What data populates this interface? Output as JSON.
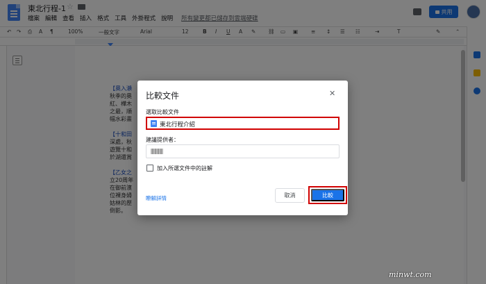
{
  "header": {
    "title": "東北行程-1",
    "menus": [
      "檔案",
      "編輯",
      "查看",
      "插入",
      "格式",
      "工具",
      "外掛程式",
      "說明"
    ],
    "saved_status": "所有變更都已儲存到雲端硬碟",
    "share_label": "共用"
  },
  "toolbar": {
    "zoom": "100%",
    "style": "一般文字",
    "font": "Arial",
    "size": "12"
  },
  "document": {
    "lines": [
      "【奧入瀨",
      "秋季的奧",
      "紅、樺木",
      "之最，順",
      "幅水彩畫",
      "",
      "【十和田",
      "深處，秋",
      "遊覽十和",
      "於湖還賞",
      "",
      "【乙女之",
      "立20周年",
      "在御前濱",
      "位裸身婦",
      "姑林的歷",
      "倒影。"
    ]
  },
  "dialog": {
    "title": "比較文件",
    "select_label": "選取比較文件",
    "selected_doc": "東北行程介紹",
    "author_label": "建議提供者：",
    "include_comments_label": "加入所選文件中的註解",
    "learn_more": "瞭解詳情",
    "cancel_label": "取消",
    "compare_label": "比較"
  },
  "watermark": "minwt.com"
}
